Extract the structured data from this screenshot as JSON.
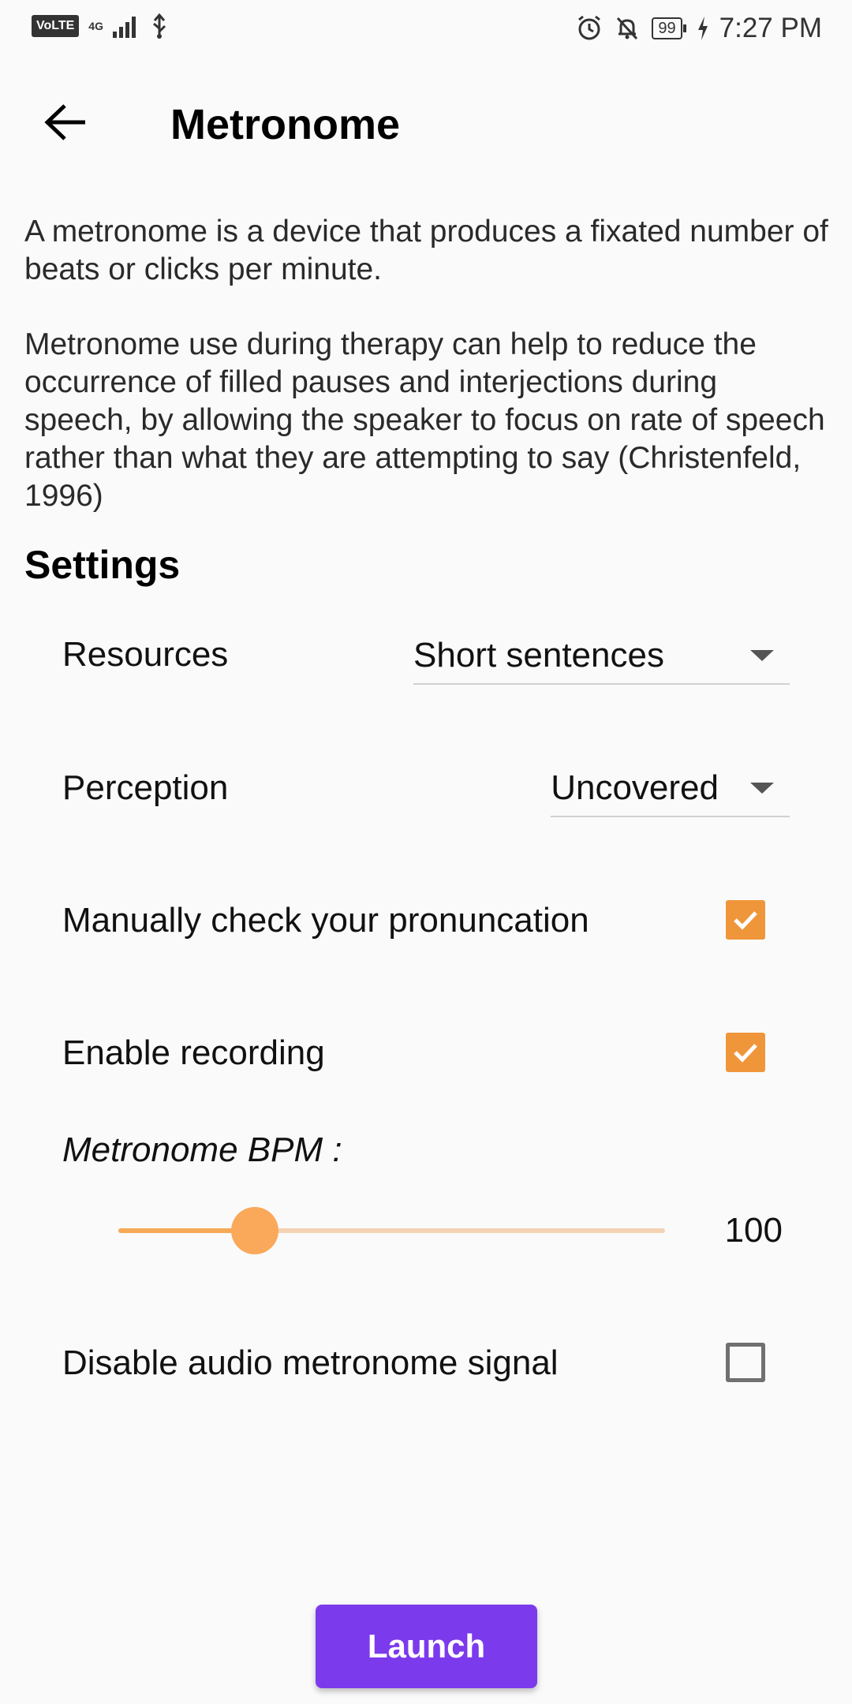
{
  "status_bar": {
    "volte": "VoLTE",
    "network": "4G",
    "battery": "99",
    "time": "7:27 PM",
    "icons": [
      "signal-icon",
      "usb-icon",
      "alarm-icon",
      "notifications-off-icon",
      "battery-icon",
      "charging-icon"
    ]
  },
  "app_bar": {
    "title": "Metronome",
    "back_icon": "arrow-back-icon"
  },
  "description": {
    "paragraph_1": "A metronome is a device that produces a fixated number of beats or clicks per minute.",
    "paragraph_2": "Metronome use during therapy can help to reduce the occurrence of filled pauses and interjections during speech, by allowing the speaker to focus on rate of speech rather than what they are attempting to say (Christenfeld, 1996)"
  },
  "settings": {
    "heading": "Settings",
    "resources": {
      "label": "Resources",
      "selected": "Short sentences"
    },
    "perception": {
      "label": "Perception",
      "selected": "Uncovered"
    },
    "manual_check": {
      "label": "Manually check your pronuncation",
      "checked": true
    },
    "enable_recording": {
      "label": "Enable recording",
      "checked": true
    },
    "bpm": {
      "label": "Metronome BPM :",
      "value": "100",
      "slider_fraction": 0.25
    },
    "disable_audio": {
      "label": "Disable audio metronome signal",
      "checked": false
    }
  },
  "launch_button": {
    "label": "Launch"
  },
  "colors": {
    "accent": "#f0963a",
    "slider_active": "#f6a957",
    "slider_inactive": "#f3d3b3",
    "button": "#7c3aed",
    "background": "#fafafa"
  }
}
